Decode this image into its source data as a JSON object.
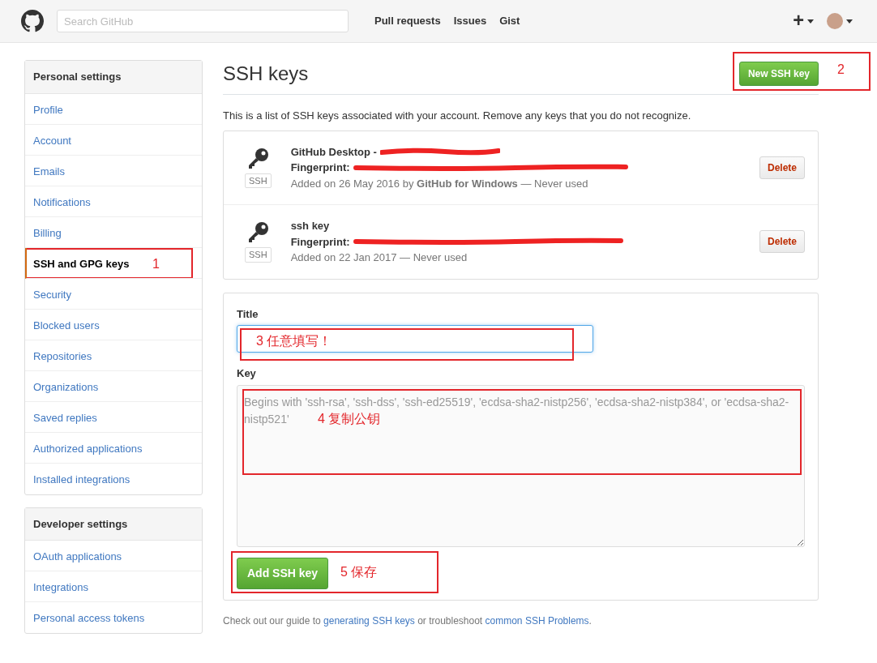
{
  "header": {
    "search": {
      "placeholder": "Search GitHub"
    },
    "nav": [
      "Pull requests",
      "Issues",
      "Gist"
    ],
    "plus": "+"
  },
  "sidebar": [
    {
      "title": "Personal settings",
      "items": [
        {
          "label": "Profile",
          "selected": false
        },
        {
          "label": "Account",
          "selected": false
        },
        {
          "label": "Emails",
          "selected": false
        },
        {
          "label": "Notifications",
          "selected": false
        },
        {
          "label": "Billing",
          "selected": false
        },
        {
          "label": "SSH and GPG keys",
          "selected": true,
          "annotation": "1"
        },
        {
          "label": "Security",
          "selected": false
        },
        {
          "label": "Blocked users",
          "selected": false
        },
        {
          "label": "Repositories",
          "selected": false
        },
        {
          "label": "Organizations",
          "selected": false
        },
        {
          "label": "Saved replies",
          "selected": false
        },
        {
          "label": "Authorized applications",
          "selected": false
        },
        {
          "label": "Installed integrations",
          "selected": false
        }
      ]
    },
    {
      "title": "Developer settings",
      "items": [
        {
          "label": "OAuth applications",
          "selected": false
        },
        {
          "label": "Integrations",
          "selected": false
        },
        {
          "label": "Personal access tokens",
          "selected": false
        }
      ]
    }
  ],
  "main": {
    "title": "SSH keys",
    "new_button": {
      "label": "New SSH key",
      "annotation": "2"
    },
    "intro": "This is a list of SSH keys associated with your account. Remove any keys that you do not recognize.",
    "keys": [
      {
        "badge": "SSH",
        "title": "GitHub Desktop -",
        "title_redacted": true,
        "fingerprint_label": "Fingerprint:",
        "added": "Added on 26 May 2016 by **GitHub for Windows** — Never used",
        "delete": "Delete"
      },
      {
        "badge": "SSH",
        "title": "ssh key",
        "title_redacted": false,
        "fingerprint_label": "Fingerprint:",
        "added": "Added on 22 Jan 2017 — Never used",
        "delete": "Delete"
      }
    ],
    "form": {
      "title_label": "Title",
      "title_annotation": "3 任意填写！",
      "key_label": "Key",
      "key_placeholder": "Begins with 'ssh-rsa', 'ssh-dss', 'ssh-ed25519', 'ecdsa-sha2-nistp256', 'ecdsa-sha2-nistp384', or 'ecdsa-sha2-nistp521'",
      "key_annotation": "4 复制公钥",
      "submit": "Add SSH key",
      "submit_annotation": "5 保存"
    },
    "footer_parts": [
      {
        "kind": "text",
        "text": "Check out our guide to "
      },
      {
        "kind": "link",
        "text": "generating SSH keys"
      },
      {
        "kind": "text",
        "text": " or troubleshoot "
      },
      {
        "kind": "link",
        "text": "common SSH Problems"
      },
      {
        "kind": "text",
        "text": "."
      }
    ]
  }
}
